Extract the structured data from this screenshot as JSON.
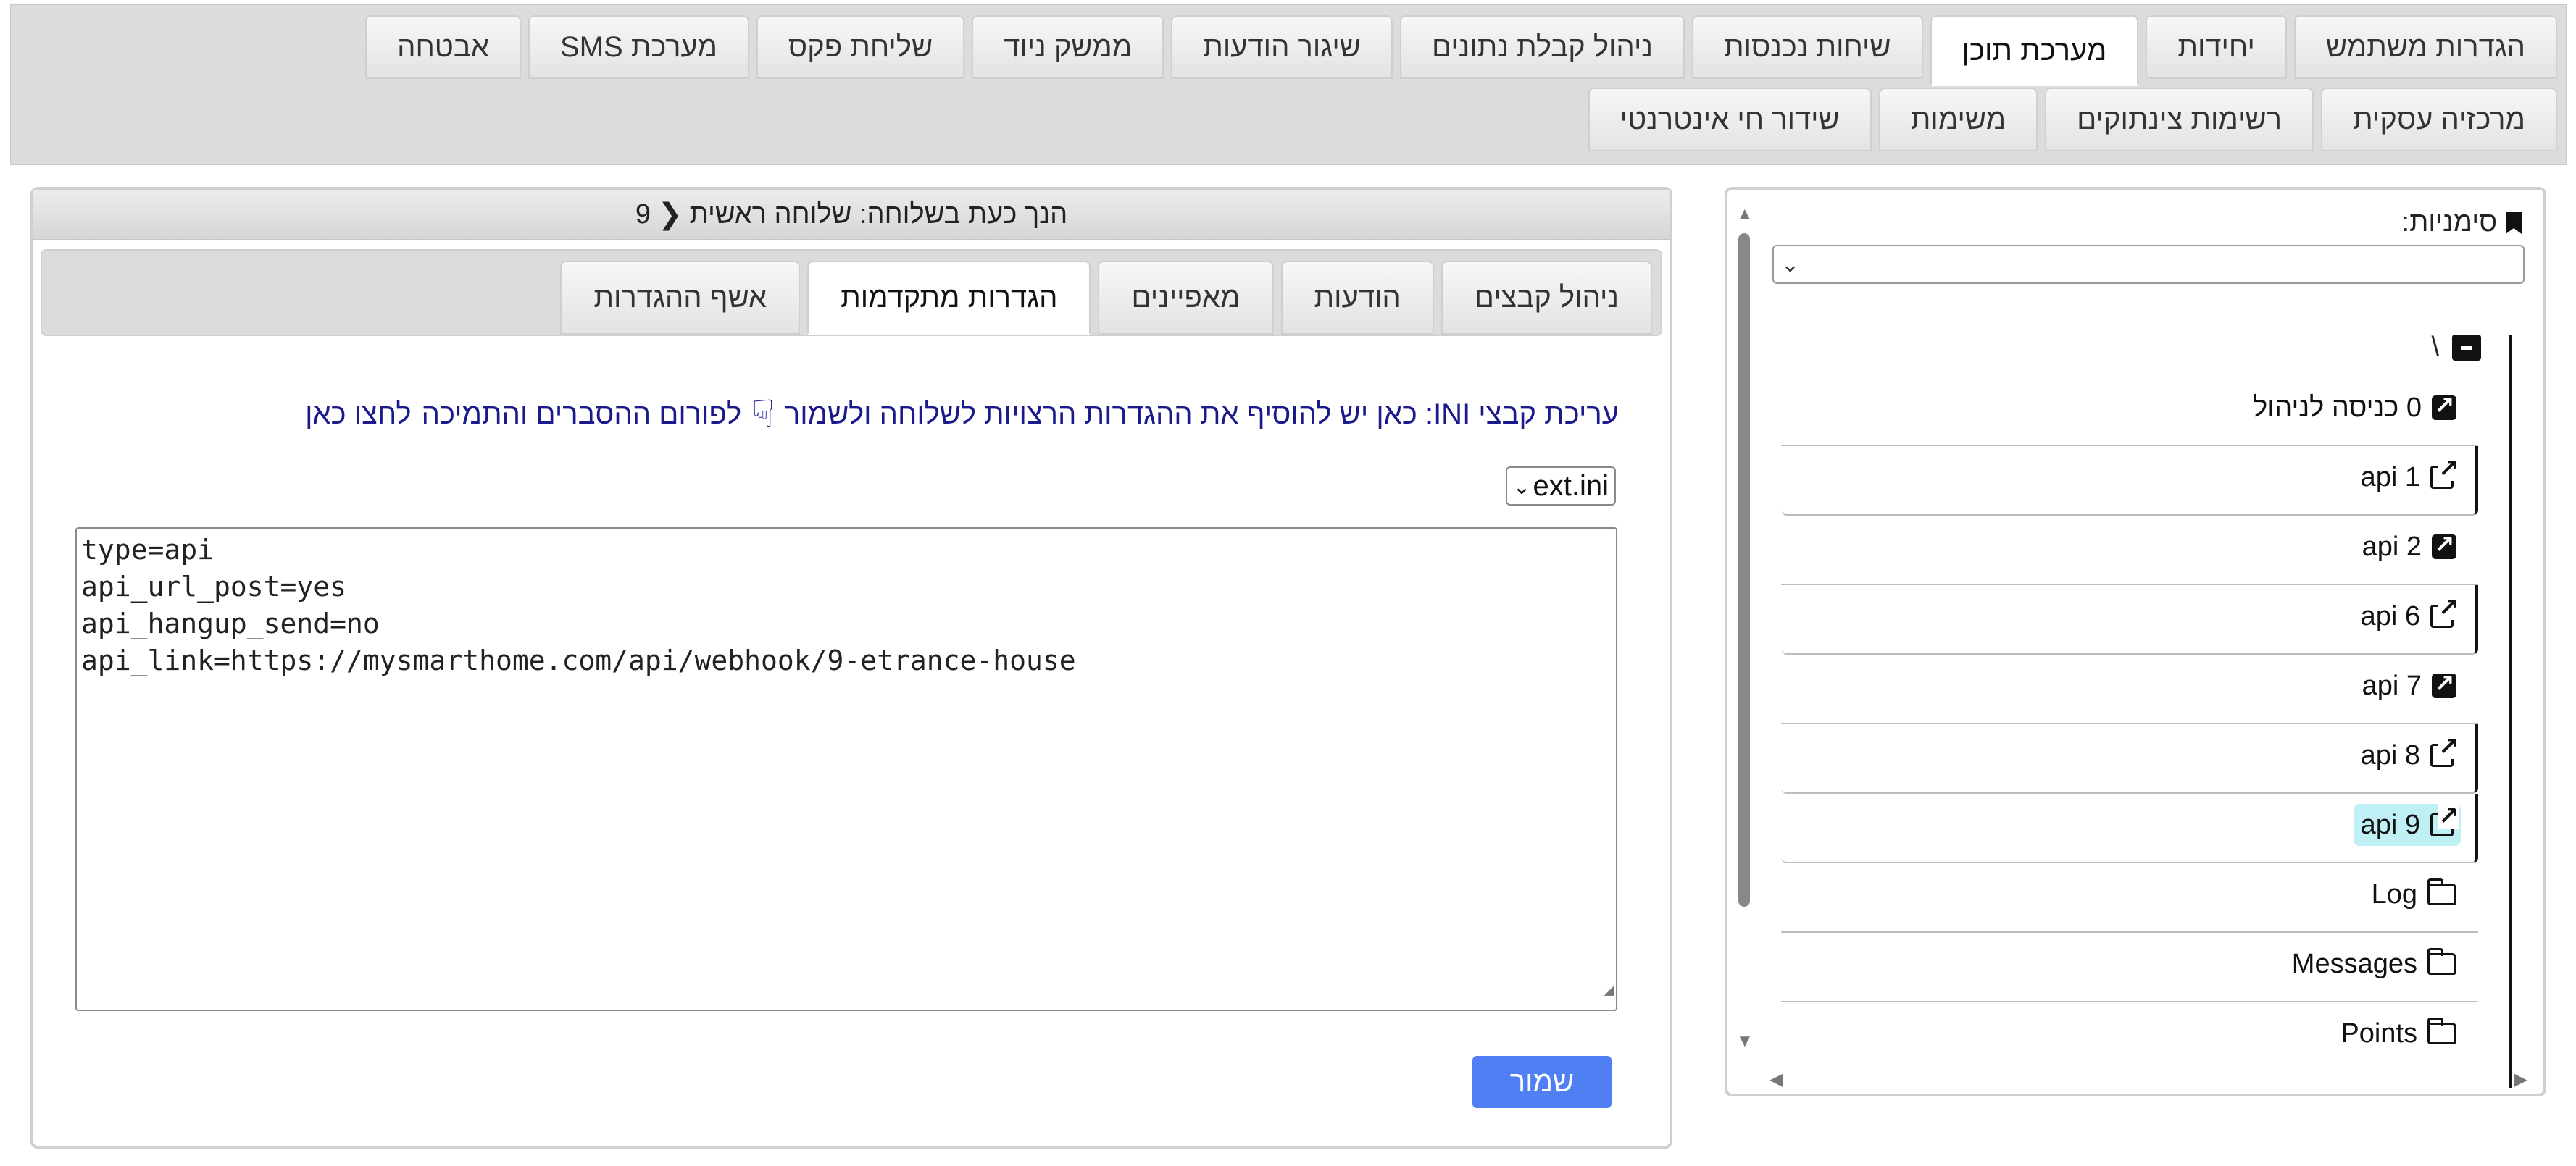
{
  "topnav": {
    "row1": [
      "הגדרות משתמש",
      "יחידות",
      "מערכת תוכן",
      "שיחות נכנסות",
      "ניהול קבלת נתונים",
      "שיגור הודעות",
      "ממשק ניוד",
      "שליחת פקס",
      "מערכת SMS",
      "אבטחה"
    ],
    "row2": [
      "מרכזיה עסקית",
      "רשימות צינתוקים",
      "משימות",
      "שידור חי אינטרנטי"
    ],
    "active": "מערכת תוכן"
  },
  "sidebar": {
    "bookmarks_label": "סימניות:",
    "root": "\\",
    "items": [
      {
        "label": "0 כניסה לניהול",
        "icon": "shortcut-solid-icon"
      },
      {
        "label": "api 1",
        "icon": "external-link-icon"
      },
      {
        "label": "api 2",
        "icon": "shortcut-solid-icon"
      },
      {
        "label": "api 6",
        "icon": "external-link-icon"
      },
      {
        "label": "api 7",
        "icon": "shortcut-solid-icon"
      },
      {
        "label": "api 8",
        "icon": "external-link-icon"
      },
      {
        "label": "api 9",
        "icon": "external-link-icon",
        "selected": true
      },
      {
        "label": "Log",
        "icon": "folder-icon"
      },
      {
        "label": "Messages",
        "icon": "folder-icon"
      },
      {
        "label": "Points",
        "icon": "folder-icon"
      }
    ]
  },
  "main": {
    "header_prefix": "הנך כעת בשלוחה: שלוחה ראשית",
    "header_ext": "9",
    "tabs": [
      "ניהול קבצים",
      "הודעות",
      "מאפיינים",
      "הגדרות מתקדמות",
      "אשף ההגדרות"
    ],
    "active_tab": "הגדרות מתקדמות",
    "ini_text": "עריכת קבצי INI: כאן יש להוסיף את ההגדרות הרצויות לשלוחה ולשמור",
    "forum_text": "לפורום ההסברים והתמיכה",
    "forum_link": "לחצו כאן",
    "file_select": "ext.ini",
    "editor_lines": [
      "type=api",
      "api_url_post=yes",
      "api_hangup_send=no",
      "api_link=https://mysmarthome.com/api/webhook/9-etrance-house"
    ],
    "save_label": "שמור"
  },
  "colors": {
    "accent": "#4f7ff2",
    "selected_bg": "#bff0f5",
    "link": "#1a1a8c"
  }
}
